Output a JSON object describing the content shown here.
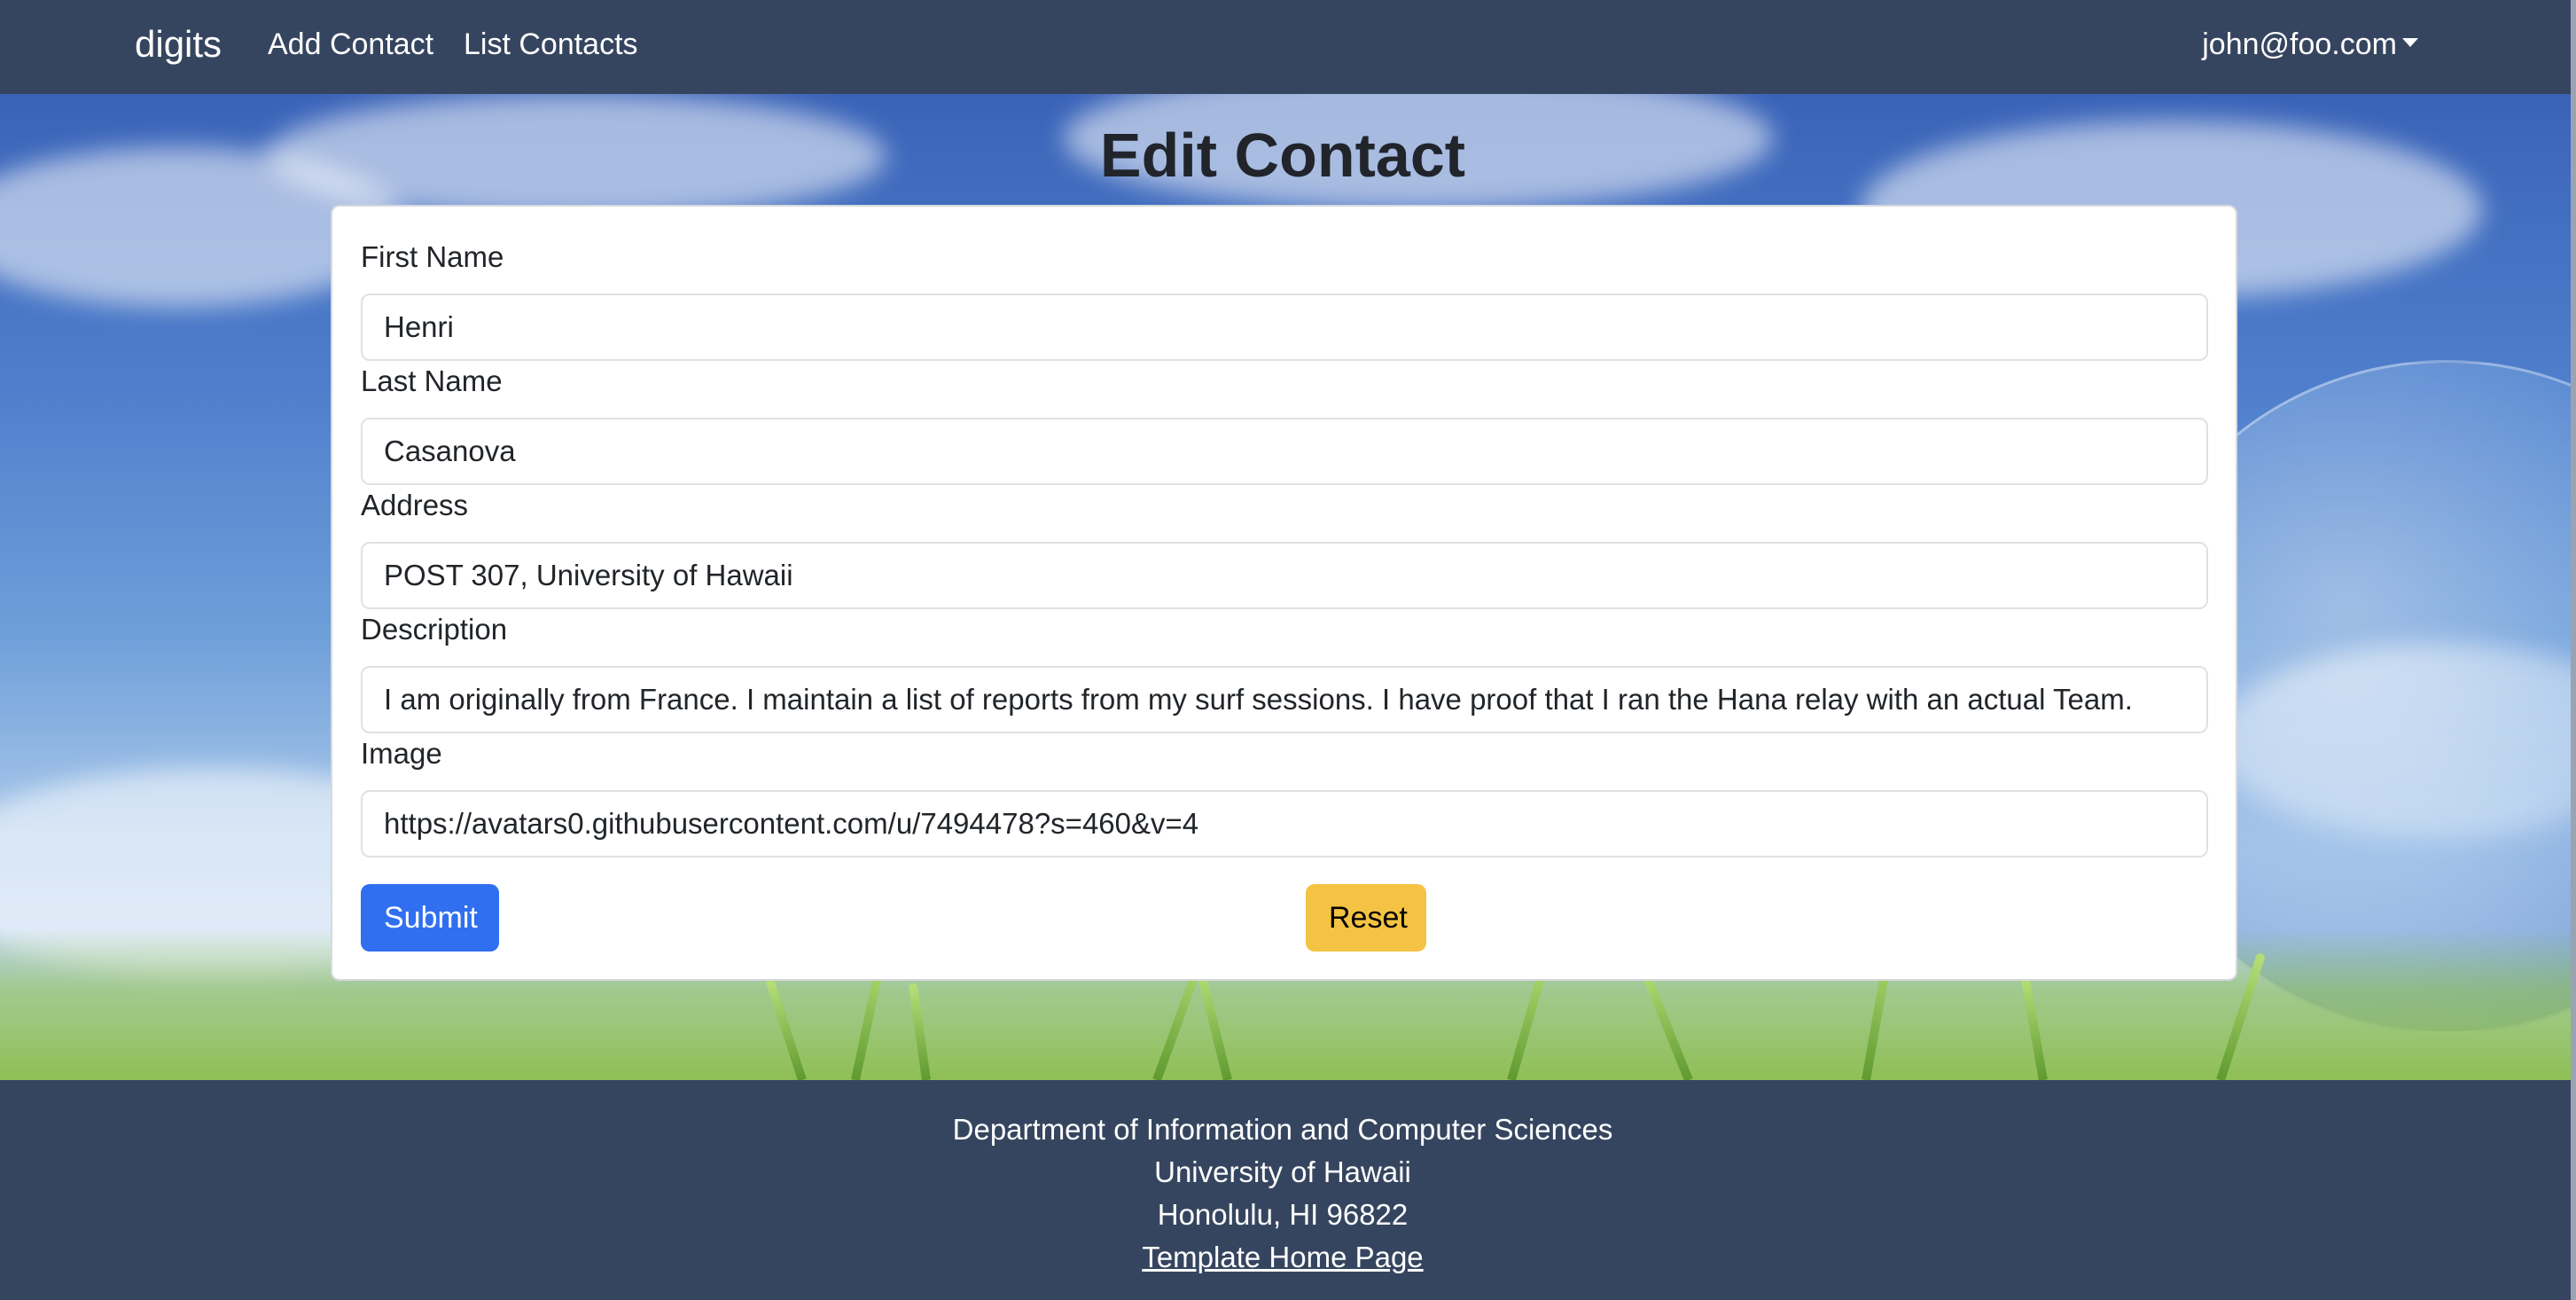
{
  "navbar": {
    "brand": "digits",
    "links": [
      "Add Contact",
      "List Contacts"
    ],
    "user": "john@foo.com"
  },
  "page": {
    "title": "Edit Contact"
  },
  "form": {
    "fields": [
      {
        "label": "First Name",
        "value": "Henri"
      },
      {
        "label": "Last Name",
        "value": "Casanova"
      },
      {
        "label": "Address",
        "value": "POST 307, University of Hawaii"
      },
      {
        "label": "Description",
        "value": "I am originally from France. I maintain a list of reports from my surf sessions. I have proof that I ran the Hana relay with an actual Team."
      },
      {
        "label": "Image",
        "value": "https://avatars0.githubusercontent.com/u/7494478?s=460&v=4"
      }
    ],
    "submit_label": "Submit",
    "reset_label": "Reset"
  },
  "footer": {
    "line1": "Department of Information and Computer Sciences",
    "line2": "University of Hawaii",
    "line3": "Honolulu, HI 96822",
    "link": "Template Home Page"
  },
  "colors": {
    "navbar_bg": "#36455f",
    "submit_bg": "#2f6ff0",
    "reset_bg": "#f5c343"
  }
}
